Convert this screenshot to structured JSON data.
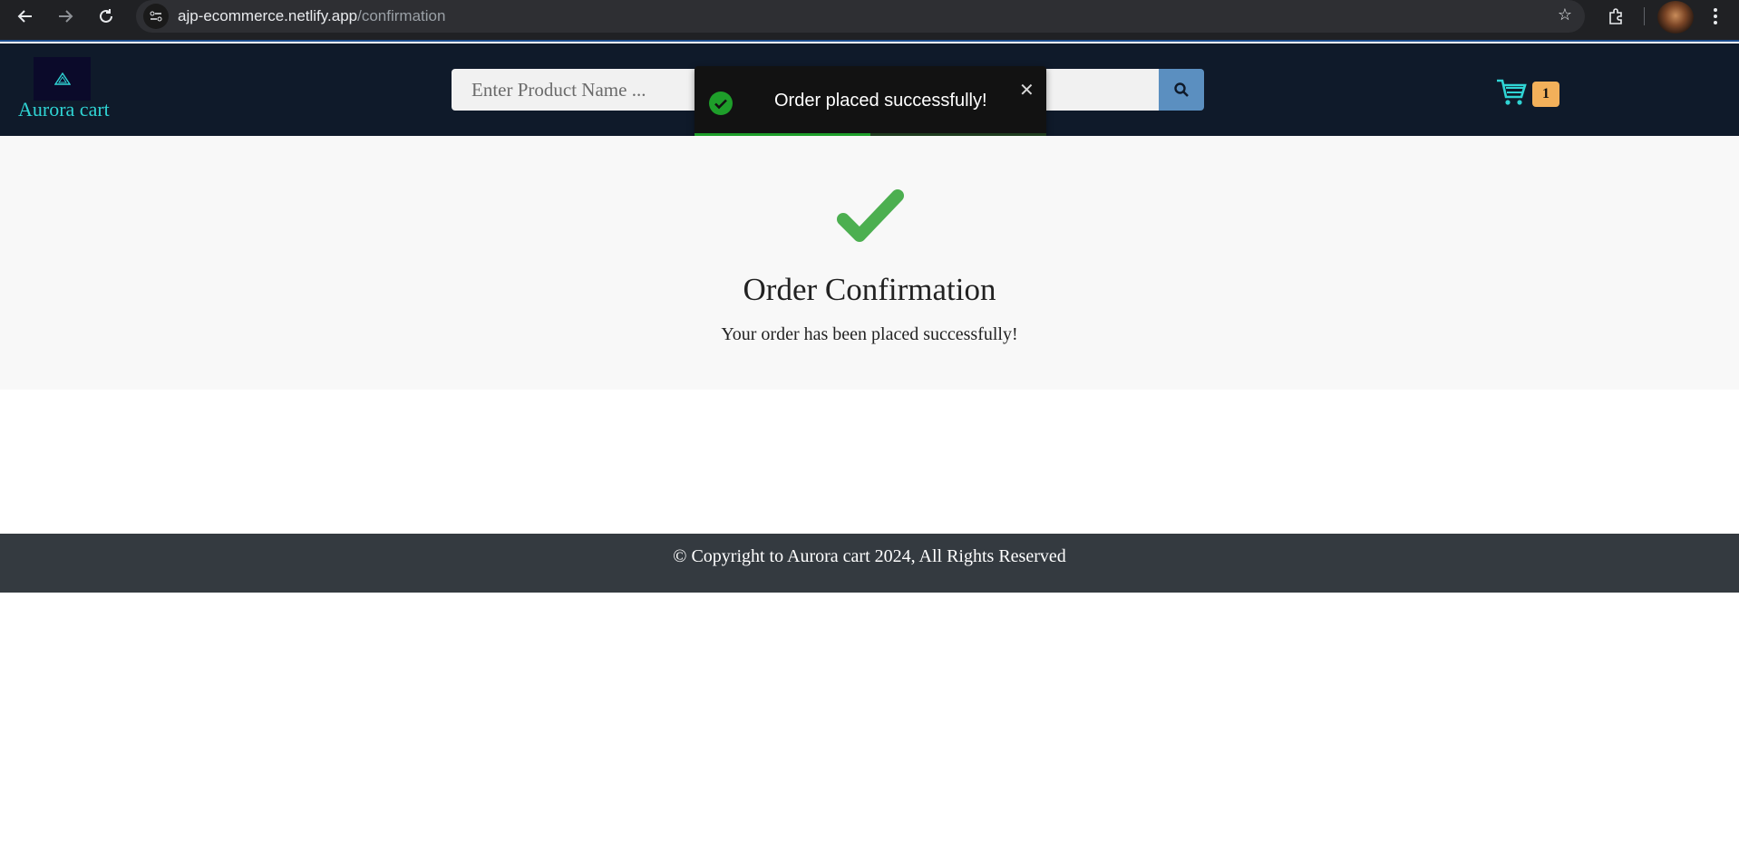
{
  "browser": {
    "url_host": "ajp-ecommerce.netlify.app",
    "url_path": "/confirmation",
    "icons": [
      "back-arrow-icon",
      "forward-arrow-icon",
      "reload-icon",
      "site-info-icon",
      "star-icon",
      "extensions-icon",
      "avatar",
      "menu-icon"
    ]
  },
  "header": {
    "brand": "Aurora cart",
    "search_placeholder": "Enter Product Name ...",
    "cart_count": "1",
    "colors": {
      "background": "#0f1a2a",
      "brand": "#2fd4d4",
      "search_button": "#5b8fc0",
      "badge": "#f2b05a"
    }
  },
  "toast": {
    "message": "Order placed successfully!",
    "close": "✕",
    "progress_fraction": 0.5,
    "colors": {
      "success": "#1e9e2a"
    }
  },
  "main": {
    "title": "Order Confirmation",
    "message": "Your order has been placed successfully!",
    "check_color": "#4caf50"
  },
  "footer": {
    "text": "© Copyright to Aurora cart 2024, All Rights Reserved"
  }
}
